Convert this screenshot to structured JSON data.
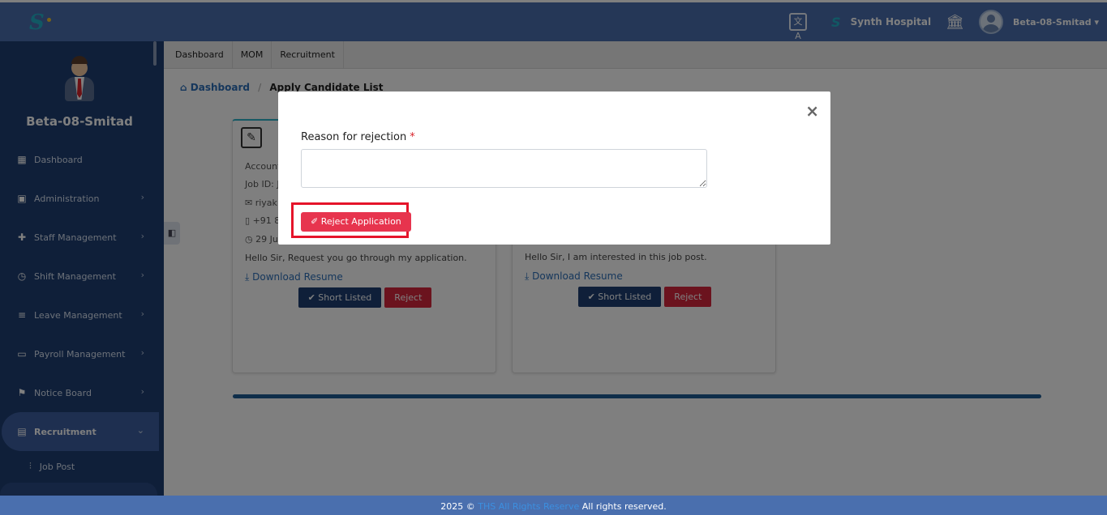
{
  "topbar": {
    "logo_text": "S",
    "translate_icon_text": "文A",
    "mini_logo_text": "S",
    "hospital_name": "Synth Hospital",
    "user_name": "Beta-08-Smitad ▾"
  },
  "sidebar": {
    "profile_name": "Beta-08-Smitad",
    "items": [
      {
        "label": "Dashboard",
        "icon": "dashboard-icon",
        "glyph": "▦",
        "chevron": ""
      },
      {
        "label": "Administration",
        "icon": "id-badge-icon",
        "glyph": "▣",
        "chevron": "›"
      },
      {
        "label": "Staff Management",
        "icon": "users-add-icon",
        "glyph": "✚",
        "chevron": "›"
      },
      {
        "label": "Shift Management",
        "icon": "calendar-clock-icon",
        "glyph": "◷",
        "chevron": "›"
      },
      {
        "label": "Leave Management",
        "icon": "list-icon",
        "glyph": "≡",
        "chevron": "›"
      },
      {
        "label": "Payroll Management",
        "icon": "money-icon",
        "glyph": "▭",
        "chevron": "›"
      },
      {
        "label": "Notice Board",
        "icon": "flag-icon",
        "glyph": "⚑",
        "chevron": "›"
      },
      {
        "label": "Recruitment",
        "icon": "recruitment-icon",
        "glyph": "▤",
        "chevron": "⌄"
      }
    ],
    "sub_items": [
      {
        "label": "Job Post",
        "icon": "sliders-icon",
        "glyph": "⫶"
      }
    ]
  },
  "tabs": [
    "Dashboard",
    "MOM",
    "Recruitment"
  ],
  "breadcrumb": {
    "home_icon": "⌂",
    "home": "Dashboard",
    "sep": "/",
    "current": "Apply Candidate List"
  },
  "collapse_glyph": "◧",
  "cards": [
    {
      "role": "Account",
      "job_id": "Job ID: J",
      "email": "riyak",
      "phone": "+91 8",
      "date": "29 Ju",
      "message": "Hello Sir, Request you go through my application.",
      "download": "Download Resume",
      "short_listed": "✔ Short Listed",
      "reject": "Reject"
    },
    {
      "role": "",
      "job_id": "",
      "email": "",
      "phone": "",
      "date": "",
      "message": "Hello Sir, I am interested in this job post.",
      "download": "Download Resume",
      "short_listed": "✔ Short Listed",
      "reject": "Reject"
    }
  ],
  "card_icons": {
    "doc": "✎",
    "email": "✉",
    "phone": "▯",
    "clock": "◷",
    "download": "⤓"
  },
  "modal": {
    "close": "×",
    "label": "Reason for rejection",
    "required": "*",
    "textarea_value": "",
    "button": "✐ Reject Application"
  },
  "footer": {
    "prefix": "2025 ©",
    "brand": "THS All Rights Reserve",
    "suffix": "All rights reserved."
  },
  "colors": {
    "topbar": "#4a6fae",
    "sidebar": "#1f3f73",
    "accent": "#2cb3c9",
    "danger": "#d7263d",
    "highlight": "#e5142a"
  }
}
